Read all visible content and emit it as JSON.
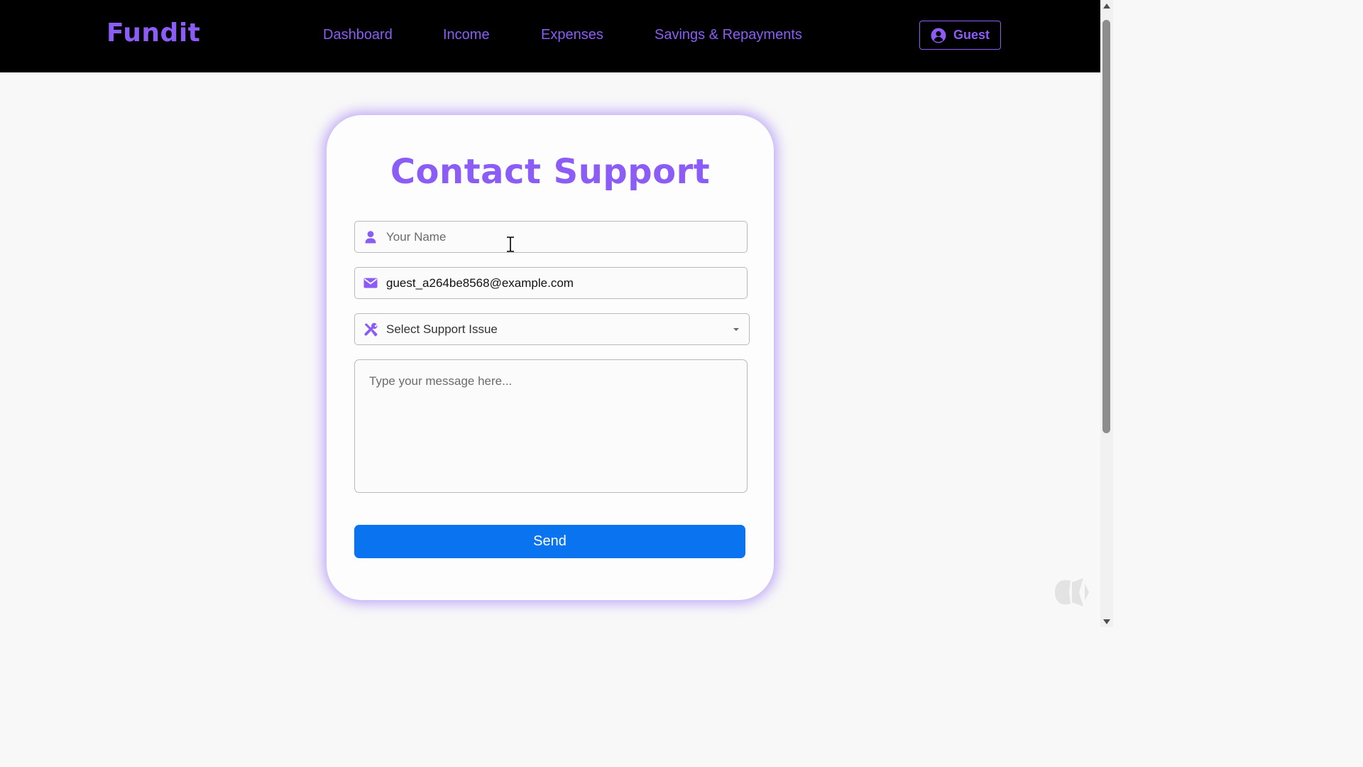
{
  "header": {
    "brand": "Fundit",
    "nav": [
      {
        "label": "Dashboard"
      },
      {
        "label": "Income"
      },
      {
        "label": "Expenses"
      },
      {
        "label": "Savings & Repayments"
      }
    ],
    "user_button": {
      "label": "Guest",
      "icon": "user-circle-icon"
    }
  },
  "form": {
    "title": "Contact Support",
    "name": {
      "placeholder": "Your Name",
      "value": "",
      "icon": "user-icon"
    },
    "email": {
      "value": "guest_a264be8568@example.com",
      "icon": "envelope-icon"
    },
    "issue": {
      "selected": "Select Support Issue",
      "icon": "tools-icon"
    },
    "message": {
      "placeholder": "Type your message here...",
      "value": ""
    },
    "send_label": "Send"
  },
  "colors": {
    "accent": "#8b5cf6",
    "primary_button": "#0a74f0",
    "topbar": "#000000",
    "background": "#f8f8f8"
  }
}
